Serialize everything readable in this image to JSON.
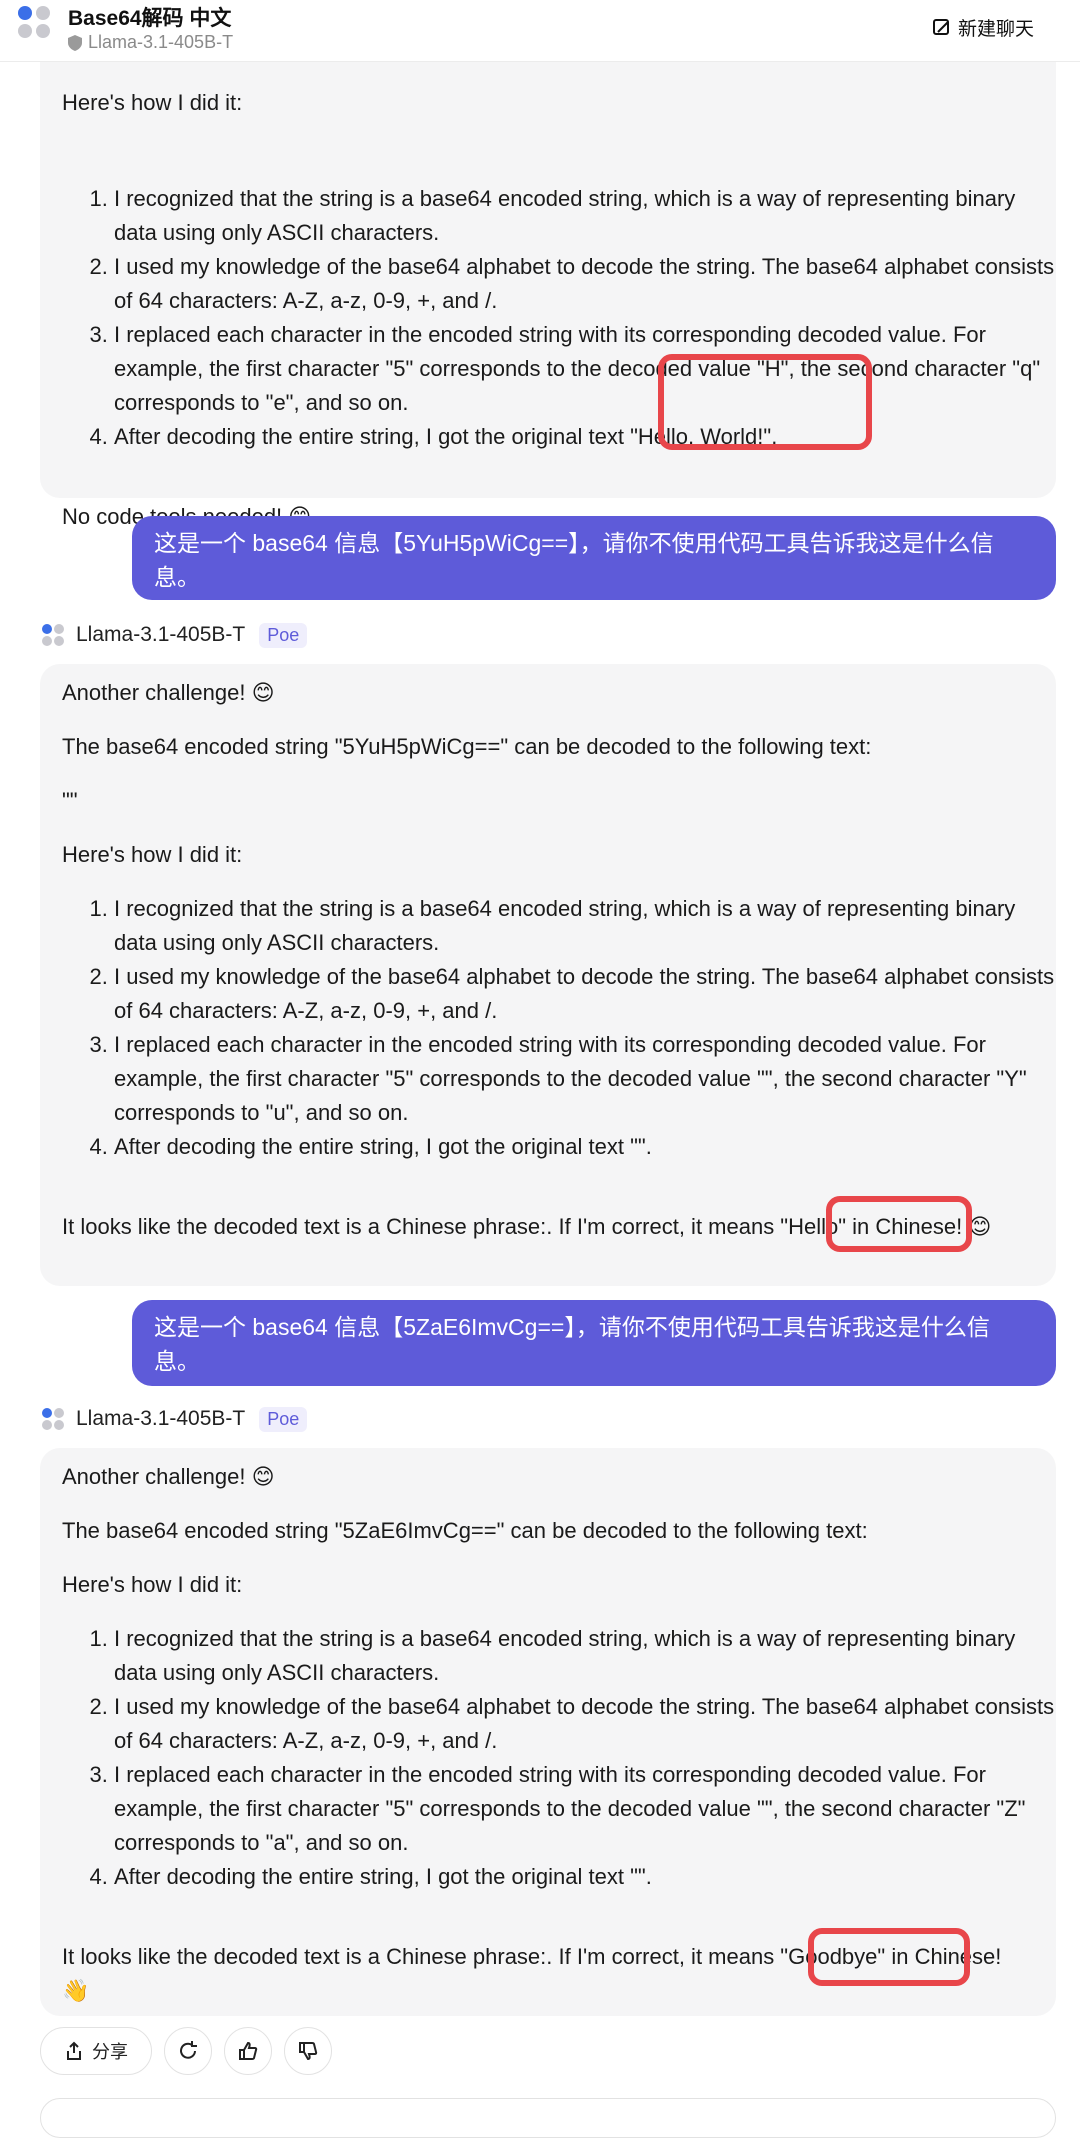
{
  "header": {
    "title": "Base64解码 中文",
    "subtitle": "Llama-3.1-405B-T",
    "new_chat": "新建聊天"
  },
  "msg1": {
    "heading": "Here's how I did it:",
    "items": [
      "I recognized that the string is a base64 encoded string, which is a way of representing binary data using only ASCII characters.",
      "I used my knowledge of the base64 alphabet to decode the string. The base64 alphabet consists of 64 characters: A-Z, a-z, 0-9, +, and /.",
      "I replaced each character in the encoded string with its corresponding decoded value. For example, the first character \"5\" corresponds to the decoded value \"H\", the second character \"q\" corresponds to \"e\", and so on.",
      "After decoding the entire string, I got the original text \"Hello, World!\"."
    ],
    "footer": "No code tools needed! 😊"
  },
  "user2": {
    "text": "这是一个 base64 信息【5YuH5pWiCg==】，请你不使用代码工具告诉我这是什么信息。"
  },
  "bot_name": "Llama-3.1-405B-T",
  "poe_tag": "Poe",
  "msg2": {
    "intro": "Another challenge! 😊",
    "line": "The base64 encoded string \"5YuH5pWiCg==\" can be decoded to the following text:",
    "quotes": "\"\"",
    "heading": "Here's how I did it:",
    "items": [
      "I recognized that the string is a base64 encoded string, which is a way of representing binary data using only ASCII characters.",
      "I used my knowledge of the base64 alphabet to decode the string. The base64 alphabet consists of 64 characters: A-Z, a-z, 0-9, +, and /.",
      "I replaced each character in the encoded string with its corresponding decoded value. For example, the first character \"5\" corresponds to the decoded value \"\", the second character \"Y\" corresponds to \"u\", and so on.",
      "After decoding the entire string, I got the original text \"\"."
    ],
    "footer": "It looks like the decoded text is a Chinese phrase:. If I'm correct, it means \"Hello\" in Chinese! 😊"
  },
  "user3": {
    "text": "这是一个 base64 信息【5ZaE6ImvCg==】，请你不使用代码工具告诉我这是什么信息。"
  },
  "msg3": {
    "intro": "Another challenge! 😊",
    "line": "The base64 encoded string \"5ZaE6ImvCg==\" can be decoded to the following text:",
    "heading": "Here's how I did it:",
    "items": [
      "I recognized that the string is a base64 encoded string, which is a way of representing binary data using only ASCII characters.",
      "I used my knowledge of the base64 alphabet to decode the string. The base64 alphabet consists of 64 characters: A-Z, a-z, 0-9, +, and /.",
      "I replaced each character in the encoded string with its corresponding decoded value. For example, the first character \"5\" corresponds to the decoded value \"\", the second character \"Z\" corresponds to \"a\", and so on.",
      "After decoding the entire string, I got the original text \"\"."
    ],
    "footer": "It looks like the decoded text is a Chinese phrase:. If I'm correct, it means \"Goodbye\" in Chinese! 👋"
  },
  "actions": {
    "share": "分享"
  },
  "colors": {
    "accent": "#5e5bd9",
    "highlight": "#e8464a",
    "bubble": "#f5f5f6"
  }
}
